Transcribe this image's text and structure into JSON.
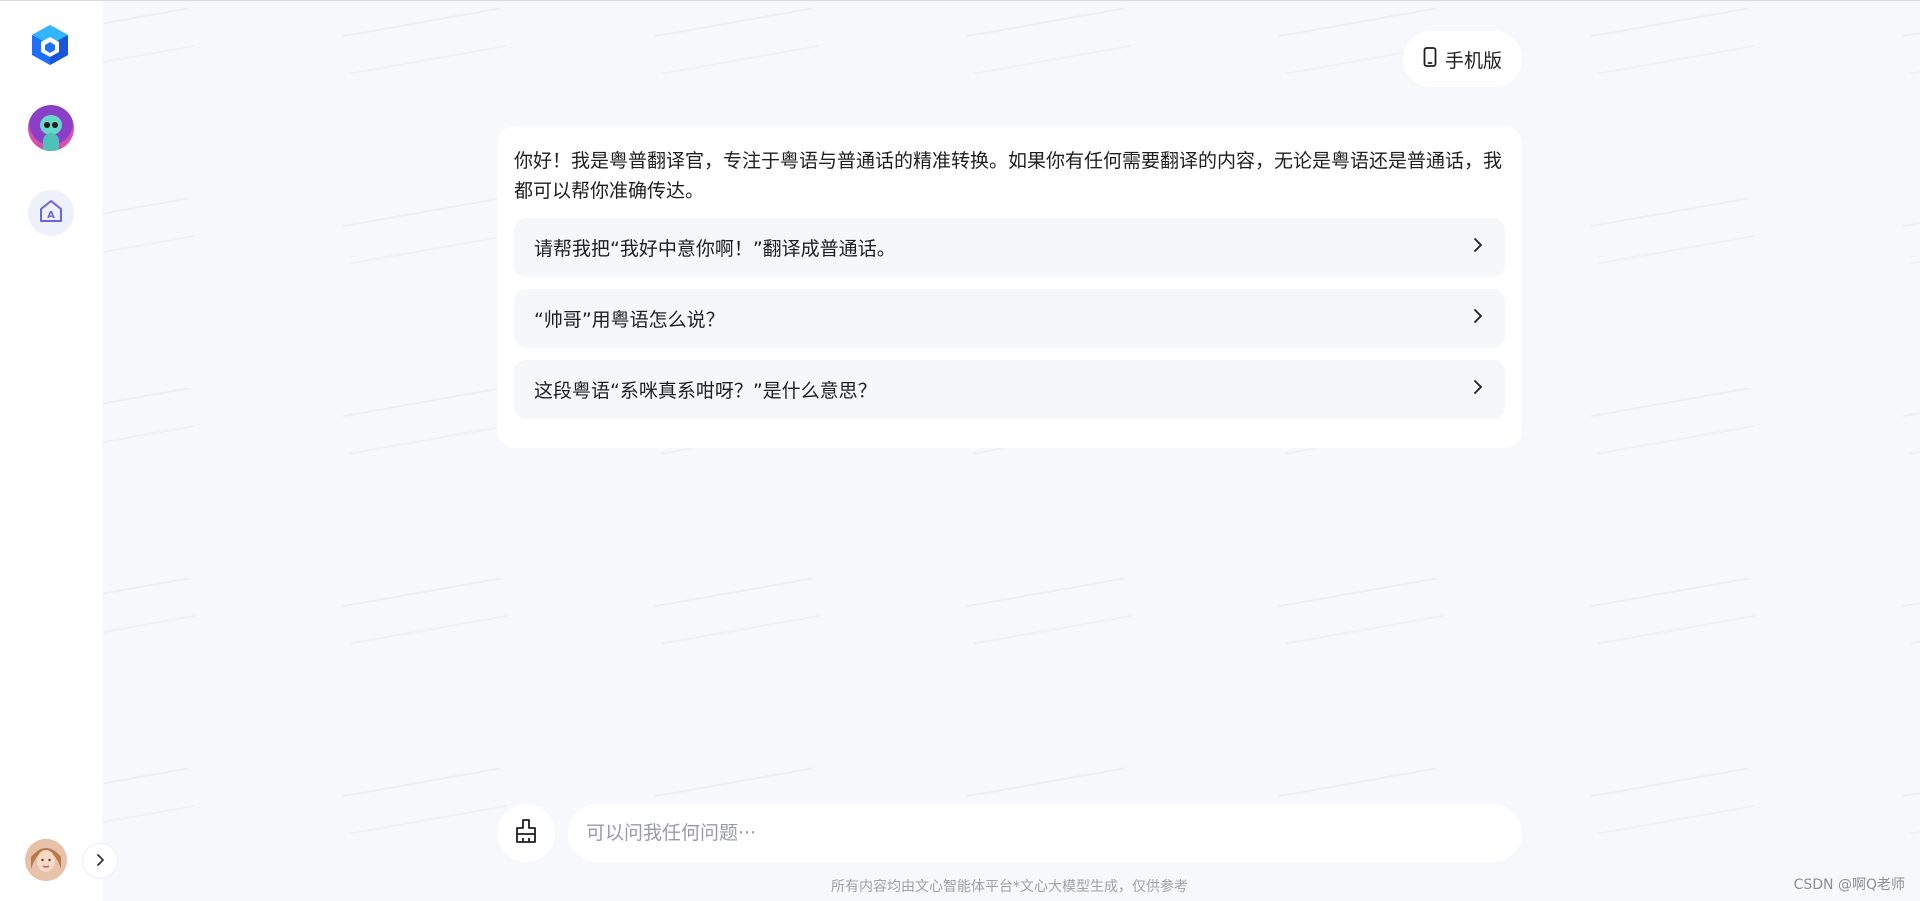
{
  "sidebar": {
    "logo_icon": "cube-logo-icon",
    "agent_avatar_icon": "alien-agent-avatar",
    "home_icon": "app-home-icon",
    "user_avatar_icon": "user-photo-avatar",
    "expand_icon": "chevron-right-icon"
  },
  "header": {
    "mobile_label": "手机版",
    "mobile_icon": "phone-icon"
  },
  "welcome": {
    "greeting": "你好！我是粤普翻译官，专注于粤语与普通话的精准转换。如果你有任何需要翻译的内容，无论是粤语还是普通话，我都可以帮你准确传达。",
    "suggestions": [
      {
        "label": "请帮我把“我好中意你啊！”翻译成普通话。"
      },
      {
        "label": "“帅哥”用粤语怎么说？"
      },
      {
        "label": "这段粤语“系咪真系咁呀？”是什么意思？"
      }
    ]
  },
  "composer": {
    "placeholder": "可以问我任何问题···",
    "clear_icon": "broom-icon"
  },
  "footer": {
    "disclaimer": "所有内容均由文心智能体平台*文心大模型生成，仅供参考",
    "credit": "CSDN @啊Q老师"
  },
  "colors": {
    "accent": "#6b63e6",
    "logo_blue": "#1e6fff",
    "logo_cyan": "#33b6ff",
    "background": "#f7f8fb"
  }
}
